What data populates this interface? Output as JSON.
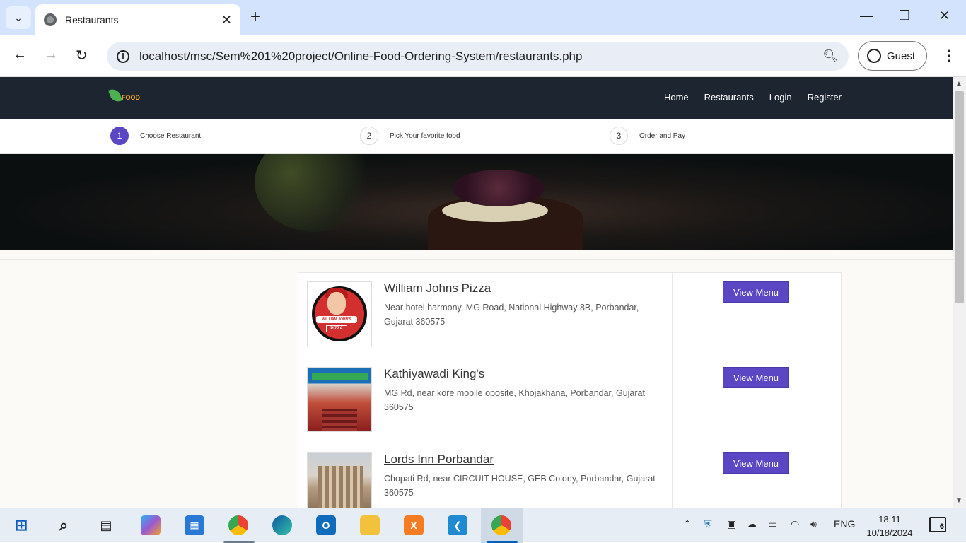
{
  "browser": {
    "tab_title": "Restaurants",
    "url": "localhost/msc/Sem%201%20project/Online-Food-Ordering-System/restaurants.php",
    "profile_label": "Guest"
  },
  "site": {
    "logo_text": "FOOD",
    "nav": [
      "Home",
      "Restaurants",
      "Login",
      "Register"
    ]
  },
  "steps": [
    {
      "num": "1",
      "label": "Choose Restaurant",
      "active": true
    },
    {
      "num": "2",
      "label": "Pick Your favorite food",
      "active": false
    },
    {
      "num": "3",
      "label": "Order and Pay",
      "active": false
    }
  ],
  "restaurants": [
    {
      "name": "William Johns Pizza",
      "address": "Near hotel harmony, MG Road, National Highway 8B, Porbandar, Gujarat 360575",
      "button": "View Menu",
      "logo_banner": "WILLIAM JOHN'S",
      "logo_tag": "PIZZA"
    },
    {
      "name": "Kathiyawadi King's",
      "address": "MG Rd, near kore mobile oposite, Khojakhana, Porbandar, Gujarat 360575",
      "button": "View Menu"
    },
    {
      "name": "Lords Inn Porbandar",
      "address": "Chopati Rd, near CIRCUIT HOUSE, GEB Colony, Porbandar, Gujarat 360575",
      "button": "View Menu"
    }
  ],
  "taskbar": {
    "lang": "ENG",
    "time": "18:11",
    "date": "10/18/2024",
    "notifications": "6"
  }
}
